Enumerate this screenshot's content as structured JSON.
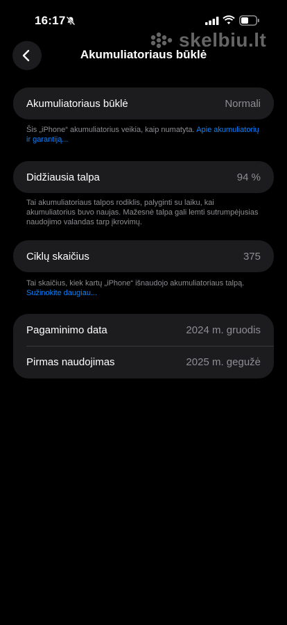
{
  "status_bar": {
    "time": "16:17"
  },
  "watermark": {
    "text": "skelbiu.lt"
  },
  "nav": {
    "title": "Akumuliatoriaus būklė"
  },
  "battery_health": {
    "label": "Akumuliatoriaus būklė",
    "value": "Normali",
    "note": "Šis „iPhone“ akumuliatorius veikia, kaip numatyta.",
    "link": "Apie akumuliatorių ir garantiją..."
  },
  "max_capacity": {
    "label": "Didžiausia talpa",
    "value": "94 %",
    "note": "Tai akumuliatoriaus talpos rodiklis, palyginti su laiku, kai akumuliatorius buvo naujas. Mažesnė talpa gali lemti sutrumpėjusias naudojimo valandas tarp įkrovimų."
  },
  "cycle_count": {
    "label": "Ciklų skaičius",
    "value": "375",
    "note": "Tai skaičius, kiek kartų „iPhone“ išnaudojo akumuliatoriaus talpą.",
    "link": "Sužinokite daugiau..."
  },
  "dates": {
    "manufacture_label": "Pagaminimo data",
    "manufacture_value": "2024 m. gruodis",
    "first_use_label": "Pirmas naudojimas",
    "first_use_value": "2025 m. gegužė"
  },
  "colors": {
    "background": "#000000",
    "card": "#1c1c1e",
    "secondary_text": "#8e8e93",
    "link": "#0a84ff"
  }
}
